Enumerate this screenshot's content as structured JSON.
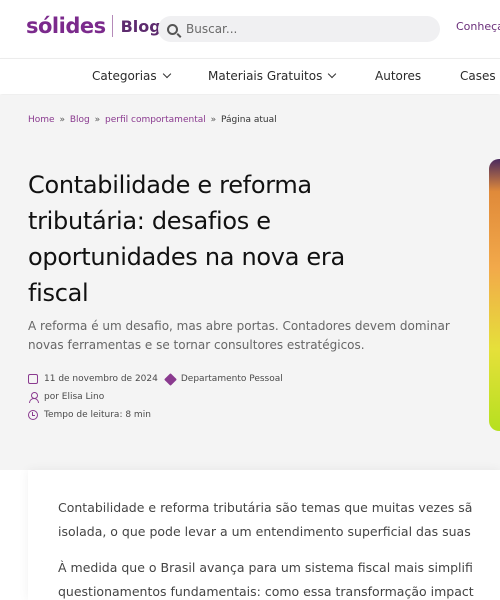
{
  "header": {
    "logo_text": "sólides",
    "logo_section": "Blog",
    "search_placeholder": "Buscar...",
    "conheca": "Conheça"
  },
  "nav": {
    "items": [
      {
        "label": "Categorias",
        "has_dropdown": true
      },
      {
        "label": "Materiais Gratuitos",
        "has_dropdown": true
      },
      {
        "label": "Autores",
        "has_dropdown": false
      },
      {
        "label": "Cases e",
        "has_dropdown": false
      }
    ]
  },
  "breadcrumb": {
    "home": "Home",
    "blog": "Blog",
    "category": "perfil comportamental",
    "separator": "»",
    "current": "Página atual"
  },
  "article": {
    "title": "Contabilidade e reforma tributária: desafios e oportunidades na nova era fiscal",
    "subtitle": "A reforma é um desafio, mas abre portas. Contadores devem dominar novas ferramentas e se tornar consultores estratégicos.",
    "date": "11 de novembro de 2024",
    "category": "Departamento Pessoal",
    "author": "por Elisa Lino",
    "reading_time": "Tempo de leitura: 8 min",
    "paragraphs": [
      "Contabilidade e reforma tributária são temas que muitas vezes sã",
      "isolada, o que pode levar a um entendimento superficial das suas",
      "À medida que o Brasil avança para um sistema fiscal mais simplifi",
      "questionamentos fundamentais: como essa transformação impact"
    ]
  },
  "colors": {
    "brand": "#7b2a8c",
    "accent_link": "#8a3a8f",
    "hero_bg": "#f4f4f4"
  }
}
